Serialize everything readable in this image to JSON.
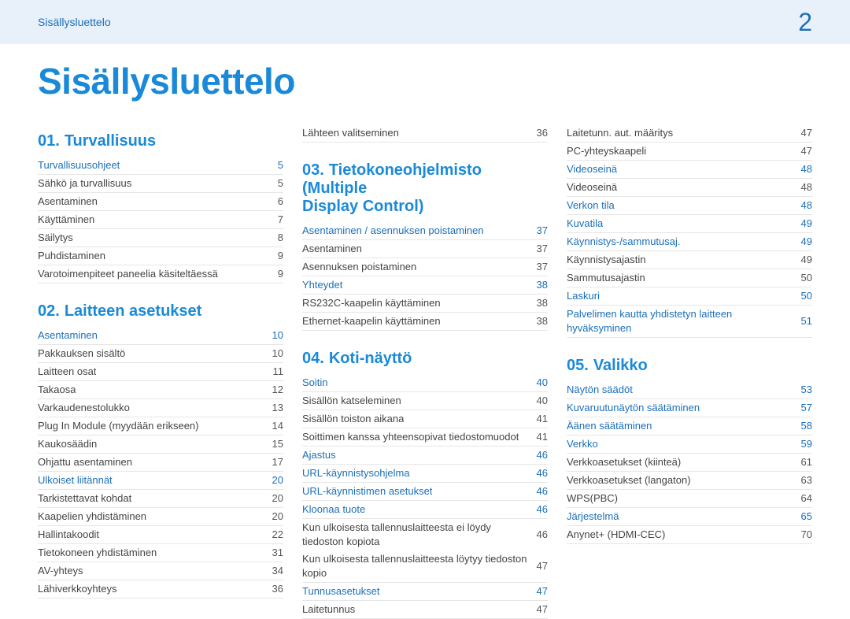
{
  "header": {
    "crumb": "Sisällysluettelo",
    "page_number": "2"
  },
  "title": "Sisällysluettelo",
  "col1": {
    "sec_a": {
      "num": "01.",
      "title": "Turvallisuus",
      "rows": [
        {
          "label": "Turvallisuusohjeet",
          "page": "5",
          "hl": true
        },
        {
          "label": "Sähkö ja turvallisuus",
          "page": "5"
        },
        {
          "label": "Asentaminen",
          "page": "6"
        },
        {
          "label": "Käyttäminen",
          "page": "7"
        },
        {
          "label": "Säilytys",
          "page": "8"
        },
        {
          "label": "Puhdistaminen",
          "page": "9"
        },
        {
          "label": "Varotoimenpiteet paneelia käsiteltäessä",
          "page": "9"
        }
      ]
    },
    "sec_b": {
      "num": "02.",
      "title": "Laitteen asetukset",
      "rows": [
        {
          "label": "Asentaminen",
          "page": "10",
          "hl": true
        },
        {
          "label": "Pakkauksen sisältö",
          "page": "10"
        },
        {
          "label": "Laitteen osat",
          "page": "11"
        },
        {
          "label": "Takaosa",
          "page": "12"
        },
        {
          "label": "Varkaudenestolukko",
          "page": "13"
        },
        {
          "label": "Plug In Module (myydään erikseen)",
          "page": "14"
        },
        {
          "label": "Kaukosäädin",
          "page": "15"
        },
        {
          "label": "Ohjattu asentaminen",
          "page": "17"
        },
        {
          "label": "Ulkoiset liitännät",
          "page": "20",
          "hl": true
        },
        {
          "label": "Tarkistettavat kohdat",
          "page": "20"
        },
        {
          "label": "Kaapelien yhdistäminen",
          "page": "20"
        },
        {
          "label": "Hallintakoodit",
          "page": "22"
        },
        {
          "label": "Tietokoneen yhdistäminen",
          "page": "31"
        },
        {
          "label": "AV-yhteys",
          "page": "34"
        },
        {
          "label": "Lähiverkkoyhteys",
          "page": "36"
        }
      ]
    }
  },
  "col2": {
    "leadrow": {
      "label": "Lähteen valitseminen",
      "page": "36"
    },
    "sec_a": {
      "num": "03.",
      "title_line1": "Tietokoneohjelmisto (Multiple",
      "title_line2": "Display Control)",
      "rows": [
        {
          "label": "Asentaminen / asennuksen poistaminen",
          "page": "37",
          "hl": true
        },
        {
          "label": "Asentaminen",
          "page": "37"
        },
        {
          "label": "Asennuksen poistaminen",
          "page": "37"
        },
        {
          "label": "Yhteydet",
          "page": "38",
          "hl": true
        },
        {
          "label": "RS232C-kaapelin käyttäminen",
          "page": "38"
        },
        {
          "label": "Ethernet-kaapelin käyttäminen",
          "page": "38"
        }
      ]
    },
    "sec_b": {
      "num": "04.",
      "title": "Koti-näyttö",
      "rows": [
        {
          "label": "Soitin",
          "page": "40",
          "hl": true
        },
        {
          "label": "Sisällön katseleminen",
          "page": "40"
        },
        {
          "label": "Sisällön toiston aikana",
          "page": "41"
        },
        {
          "label": "Soittimen kanssa yhteensopivat tiedostomuodot",
          "page": "41"
        },
        {
          "label": "Ajastus",
          "page": "46",
          "hl": true
        },
        {
          "label": "URL-käynnistysohjelma",
          "page": "46",
          "hl": true
        },
        {
          "label": "URL-käynnistimen asetukset",
          "page": "46",
          "hl": true
        },
        {
          "label": "Kloonaa tuote",
          "page": "46",
          "hl": true
        },
        {
          "label": "Kun ulkoisesta tallennuslaitteesta ei löydy tiedoston kopiota",
          "page": "46",
          "noborder": true
        },
        {
          "label": "Kun ulkoisesta tallennuslaitteesta löytyy tiedoston kopio",
          "page": "47"
        },
        {
          "label": "Tunnusasetukset",
          "page": "47",
          "hl": true
        },
        {
          "label": "Laitetunnus",
          "page": "47"
        }
      ]
    }
  },
  "col3": {
    "lead_rows": [
      {
        "label": "Laitetunn. aut. määritys",
        "page": "47"
      },
      {
        "label": "PC-yhteyskaapeli",
        "page": "47"
      },
      {
        "label": "Videoseinä",
        "page": "48",
        "hl": true
      },
      {
        "label": "Videoseinä",
        "page": "48"
      },
      {
        "label": "Verkon tila",
        "page": "48",
        "hl": true
      },
      {
        "label": "Kuvatila",
        "page": "49",
        "hl": true
      },
      {
        "label": "Käynnistys-/sammutusaj.",
        "page": "49",
        "hl": true
      },
      {
        "label": "Käynnistysajastin",
        "page": "49"
      },
      {
        "label": "Sammutusajastin",
        "page": "50"
      },
      {
        "label": "Laskuri",
        "page": "50",
        "hl": true
      },
      {
        "label": "Palvelimen kautta yhdistetyn laitteen hyväksyminen",
        "page": "51",
        "hl": true
      }
    ],
    "sec_a": {
      "num": "05.",
      "title": "Valikko",
      "rows": [
        {
          "label": "Näytön säädöt",
          "page": "53",
          "hl": true
        },
        {
          "label": "Kuvaruutunäytön säätäminen",
          "page": "57",
          "hl": true
        },
        {
          "label": "Äänen säätäminen",
          "page": "58",
          "hl": true
        },
        {
          "label": "Verkko",
          "page": "59",
          "hl": true
        },
        {
          "label": "Verkkoasetukset (kiinteä)",
          "page": "61"
        },
        {
          "label": "Verkkoasetukset (langaton)",
          "page": "63"
        },
        {
          "label": "WPS(PBC)",
          "page": "64"
        },
        {
          "label": "Järjestelmä",
          "page": "65",
          "hl": true
        },
        {
          "label": "Anynet+ (HDMI-CEC)",
          "page": "70"
        }
      ]
    }
  }
}
